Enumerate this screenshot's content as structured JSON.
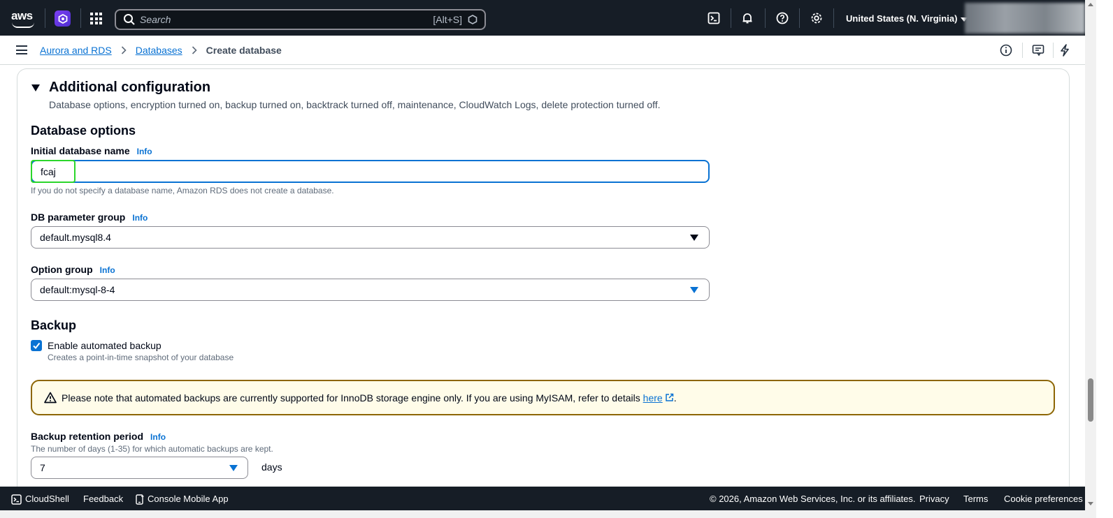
{
  "topnav": {
    "logo_text": "aws",
    "search": {
      "placeholder": "Search",
      "shortcut": "[Alt+S]"
    },
    "region": "United States (N. Virginia)"
  },
  "breadcrumb": {
    "items": [
      "Aurora and RDS",
      "Databases"
    ],
    "current": "Create database"
  },
  "section": {
    "title": "Additional configuration",
    "description": "Database options, encryption turned on, backup turned on, backtrack turned off, maintenance, CloudWatch Logs, delete protection turned off."
  },
  "database_options": {
    "heading": "Database options",
    "initial_db_name": {
      "label": "Initial database name",
      "info": "Info",
      "value": "fcaj",
      "hint": "If you do not specify a database name, Amazon RDS does not create a database."
    },
    "parameter_group": {
      "label": "DB parameter group",
      "info": "Info",
      "value": "default.mysql8.4"
    },
    "option_group": {
      "label": "Option group",
      "info": "Info",
      "value": "default:mysql-8-4"
    }
  },
  "backup": {
    "heading": "Backup",
    "enable_label": "Enable automated backup",
    "enable_checked": true,
    "enable_desc": "Creates a point-in-time snapshot of your database",
    "alert_text": "Please note that automated backups are currently supported for InnoDB storage engine only. If you are using MyISAM, refer to details ",
    "alert_link": "here",
    "alert_end": ".",
    "retention": {
      "label": "Backup retention period",
      "info": "Info",
      "hint": "The number of days (1-35) for which automatic backups are kept.",
      "value": "7",
      "unit": "days"
    }
  },
  "footer": {
    "cloudshell": "CloudShell",
    "feedback": "Feedback",
    "mobile_app": "Console Mobile App",
    "copyright": "© 2026, Amazon Web Services, Inc. or its affiliates.",
    "privacy": "Privacy",
    "terms": "Terms",
    "cookies": "Cookie preferences"
  },
  "colors": {
    "nav_bg": "#161d26",
    "link": "#0972d3",
    "warning_border": "#8d6605",
    "warning_bg": "#fffce9",
    "focus_highlight": "#2bd62b"
  }
}
